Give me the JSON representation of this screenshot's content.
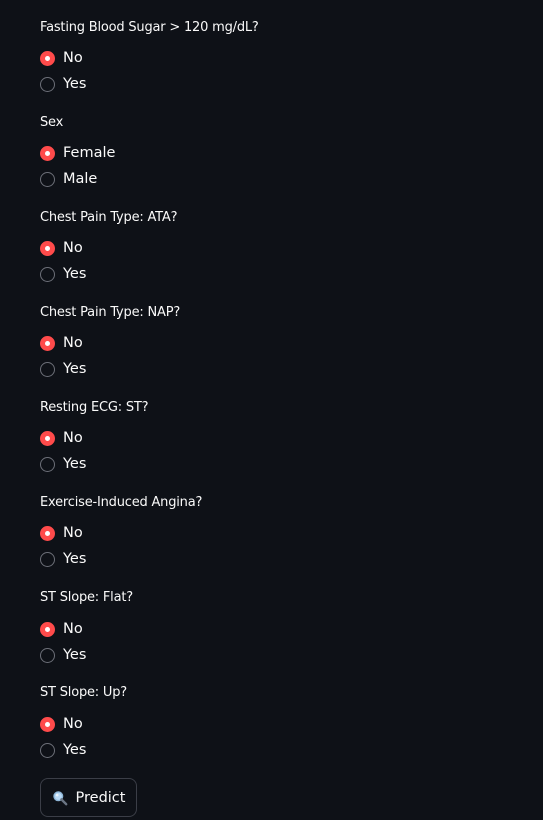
{
  "form": {
    "fasting_blood_sugar": {
      "label": "Fasting Blood Sugar > 120 mg/dL?",
      "options": [
        "No",
        "Yes"
      ],
      "selected": "No"
    },
    "sex": {
      "label": "Sex",
      "options": [
        "Female",
        "Male"
      ],
      "selected": "Female"
    },
    "chest_pain_ata": {
      "label": "Chest Pain Type: ATA?",
      "options": [
        "No",
        "Yes"
      ],
      "selected": "No"
    },
    "chest_pain_nap": {
      "label": "Chest Pain Type: NAP?",
      "options": [
        "No",
        "Yes"
      ],
      "selected": "No"
    },
    "resting_ecg_st": {
      "label": "Resting ECG: ST?",
      "options": [
        "No",
        "Yes"
      ],
      "selected": "No"
    },
    "exercise_angina": {
      "label": "Exercise-Induced Angina?",
      "options": [
        "No",
        "Yes"
      ],
      "selected": "No"
    },
    "st_slope_flat": {
      "label": "ST Slope: Flat?",
      "options": [
        "No",
        "Yes"
      ],
      "selected": "No"
    },
    "st_slope_up": {
      "label": "ST Slope: Up?",
      "options": [
        "No",
        "Yes"
      ],
      "selected": "No"
    }
  },
  "predict_button": {
    "label": "Predict",
    "icon": "magnifying-glass-icon"
  },
  "colors": {
    "background": "#0e1117",
    "text": "#fafafa",
    "accent": "#ff4b4b",
    "radio_border": "#6c6f78",
    "button_border": "#3b3e47"
  }
}
